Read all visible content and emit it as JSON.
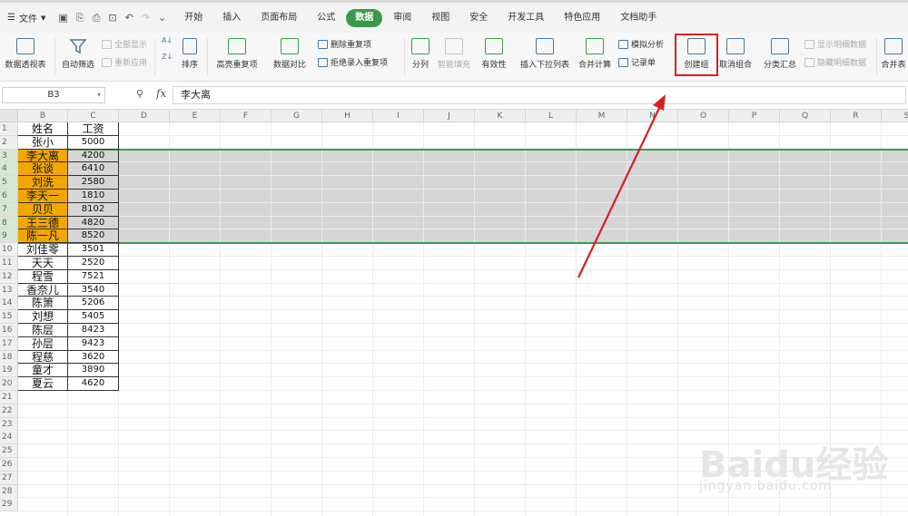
{
  "menu": {
    "file_label": "文件",
    "tabs": [
      "开始",
      "插入",
      "页面布局",
      "公式",
      "数据",
      "审阅",
      "视图",
      "安全",
      "开发工具",
      "特色应用",
      "文档助手"
    ],
    "active_tab": "数据"
  },
  "ribbon": {
    "pivot": "数据透视表",
    "autofilter": "自动筛选",
    "show_all": "全部显示",
    "reapply": "重新应用",
    "sort": "排序",
    "highlight_dup": "高亮重复项",
    "compare": "数据对比",
    "delete_dup": "删除重复项",
    "reject_dup": "拒绝录入重复项",
    "split": "分列",
    "smart_fill": "智能填充",
    "validity": "有效性",
    "insert_dropdown": "插入下拉列表",
    "consolidate": "合并计算",
    "simulate": "模拟分析",
    "record_sheet": "记录单",
    "create_group": "创建组",
    "ungroup": "取消组合",
    "subtotal": "分类汇总",
    "show_detail": "显示明细数据",
    "hide_detail": "隐藏明细数据",
    "merge_table": "合并表"
  },
  "formula_bar": {
    "cell_ref": "B3",
    "fx": "fx",
    "content": "李大离"
  },
  "sheet": {
    "columns": [
      "B",
      "C",
      "D",
      "E",
      "F",
      "G",
      "H",
      "I",
      "J",
      "K",
      "L",
      "M",
      "N",
      "O",
      "P",
      "Q",
      "R",
      "S"
    ],
    "row_numbers": [
      "1",
      "2",
      "3",
      "4",
      "5",
      "6",
      "7",
      "8",
      "9",
      "10",
      "11",
      "12",
      "13",
      "14",
      "15",
      "16",
      "17",
      "18",
      "19",
      "20",
      "21",
      "22",
      "23",
      "24",
      "25",
      "26",
      "27",
      "28",
      "29"
    ],
    "header": {
      "name": "姓名",
      "salary": "工资"
    },
    "rows": [
      {
        "name": "张小",
        "salary": "5000",
        "highlight": false
      },
      {
        "name": "李大离",
        "salary": "4200",
        "highlight": true
      },
      {
        "name": "张谈",
        "salary": "6410",
        "highlight": true
      },
      {
        "name": "刘洗",
        "salary": "2580",
        "highlight": true
      },
      {
        "name": "李天一",
        "salary": "1810",
        "highlight": true
      },
      {
        "name": "贝贝",
        "salary": "8102",
        "highlight": true
      },
      {
        "name": "王三德",
        "salary": "4820",
        "highlight": true
      },
      {
        "name": "陈一凡",
        "salary": "8520",
        "highlight": true
      },
      {
        "name": "刘佳零",
        "salary": "3501",
        "highlight": false
      },
      {
        "name": "天天",
        "salary": "2520",
        "highlight": false
      },
      {
        "name": "程雪",
        "salary": "7521",
        "highlight": false
      },
      {
        "name": "香奈儿",
        "salary": "3540",
        "highlight": false
      },
      {
        "name": "陈箫",
        "salary": "5206",
        "highlight": false
      },
      {
        "name": "刘想",
        "salary": "5405",
        "highlight": false
      },
      {
        "name": "陈层",
        "salary": "8423",
        "highlight": false
      },
      {
        "name": "孙层",
        "salary": "9423",
        "highlight": false
      },
      {
        "name": "程慈",
        "salary": "3620",
        "highlight": false
      },
      {
        "name": "童才",
        "salary": "3890",
        "highlight": false
      },
      {
        "name": "夏云",
        "salary": "4620",
        "highlight": false
      }
    ]
  },
  "watermark": {
    "brand": "Baidu经验",
    "url": "jingyan.baidu.com"
  },
  "colors": {
    "accent_green": "#3a9a4a",
    "highlight_orange": "#f2a600",
    "annotation_red": "#d62020"
  }
}
